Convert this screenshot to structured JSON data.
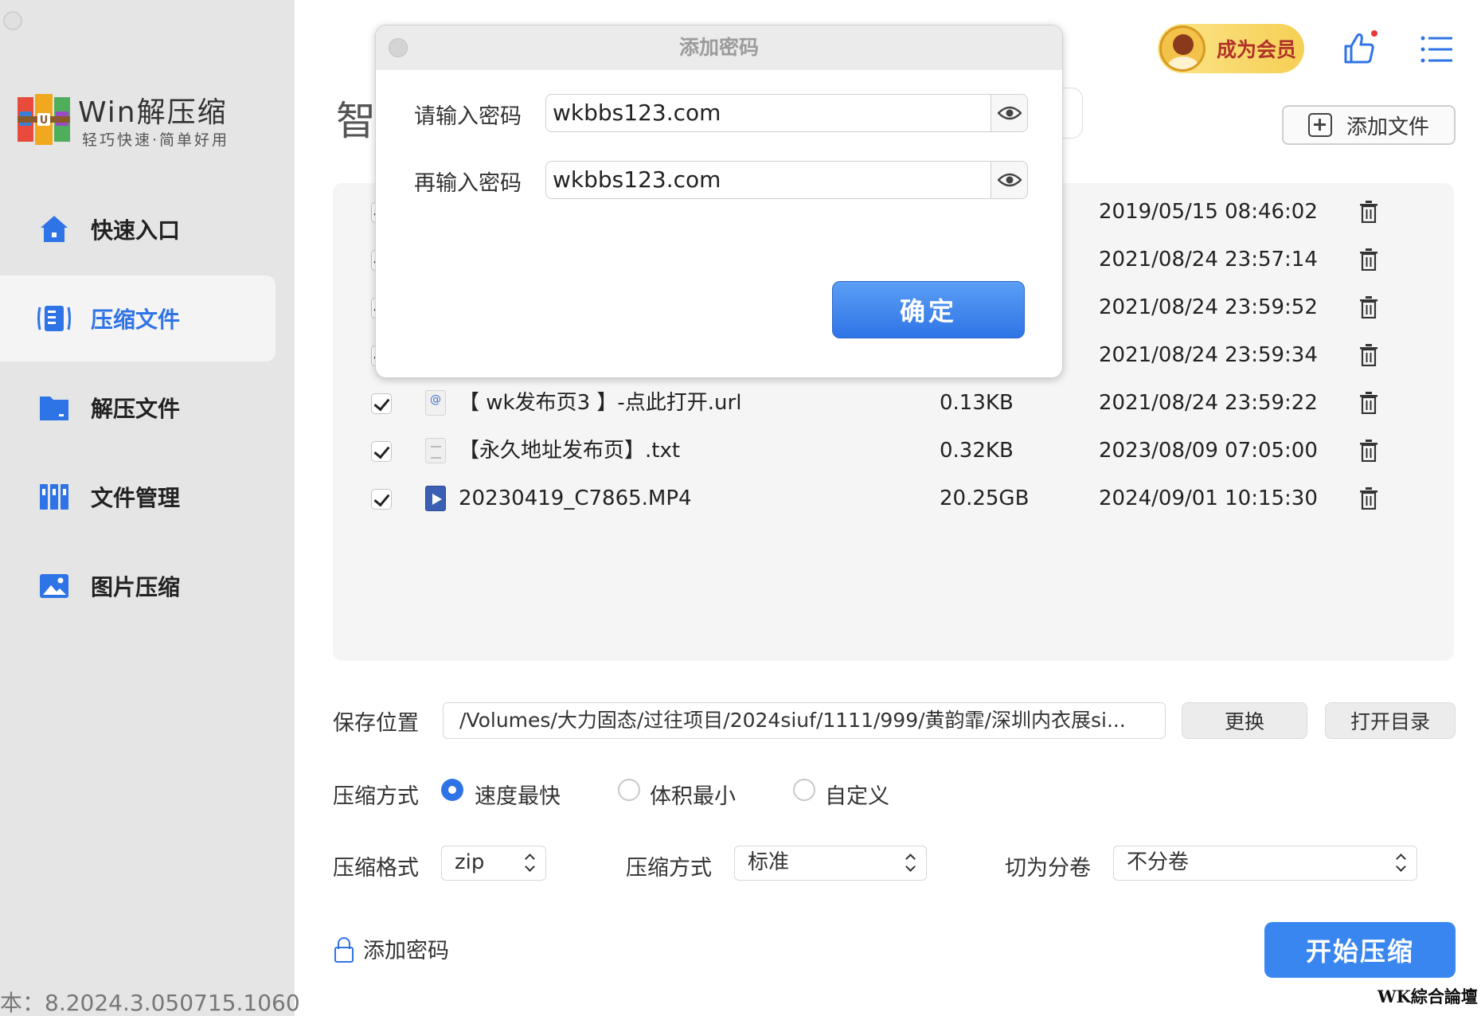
{
  "app": {
    "name": "Win解压缩",
    "slogan": "轻巧快速·简单好用",
    "version_text": "本：8.2024.3.050715.1060",
    "page_title_peek": "智"
  },
  "sidebar": {
    "items": [
      {
        "label": "快速入口",
        "icon": "home-icon"
      },
      {
        "label": "压缩文件",
        "icon": "compress-icon",
        "active": true
      },
      {
        "label": "解压文件",
        "icon": "folder-icon"
      },
      {
        "label": "文件管理",
        "icon": "files-icon"
      },
      {
        "label": "图片压缩",
        "icon": "image-icon"
      }
    ]
  },
  "header": {
    "member_label": "成为会员",
    "add_file_label": "添加文件"
  },
  "files": [
    {
      "name": "",
      "size": "",
      "date": "2019/05/15 08:46:02",
      "checked": true
    },
    {
      "name": "",
      "size": "",
      "date": "2021/08/24 23:57:14",
      "checked": true
    },
    {
      "name": "",
      "size": "",
      "date": "2021/08/24 23:59:52",
      "checked": true
    },
    {
      "name": "",
      "size": "",
      "date": "2021/08/24 23:59:34",
      "checked": true
    },
    {
      "name": "【 wk发布页3 】-点此打开.url",
      "size": "0.13KB",
      "date": "2021/08/24 23:59:22",
      "type": "url",
      "checked": true
    },
    {
      "name": "【永久地址发布页】.txt",
      "size": "0.32KB",
      "date": "2023/08/09 07:05:00",
      "type": "txt",
      "checked": true
    },
    {
      "name": "20230419_C7865.MP4",
      "size": "20.25GB",
      "date": "2024/09/01 10:15:30",
      "type": "mp4",
      "checked": true
    }
  ],
  "save": {
    "label": "保存位置",
    "path": "/Volumes/大力固态/过往项目/2024siuf/1111/999/黄韵霏/深圳内衣展si...",
    "change_label": "更换",
    "open_dir_label": "打开目录"
  },
  "mode": {
    "label": "压缩方式",
    "options": [
      "速度最快",
      "体积最小",
      "自定义"
    ],
    "selected": "速度最快"
  },
  "format": {
    "label": "压缩格式",
    "value": "zip",
    "method_label": "压缩方式",
    "method_value": "标准",
    "split_label": "切为分卷",
    "split_value": "不分卷"
  },
  "footer": {
    "add_password_label": "添加密码",
    "start_label": "开始压缩",
    "watermark": "WK綜合論壇"
  },
  "modal": {
    "title": "添加密码",
    "password_label": "请输入密码",
    "password_value": "wkbbs123.com",
    "confirm_label": "再输入密码",
    "confirm_value": "wkbbs123.com",
    "ok_label": "确定"
  },
  "colors": {
    "accent": "#2f74e6",
    "sidebar_bg": "#e5e5e5",
    "member_text": "#b0322a"
  }
}
